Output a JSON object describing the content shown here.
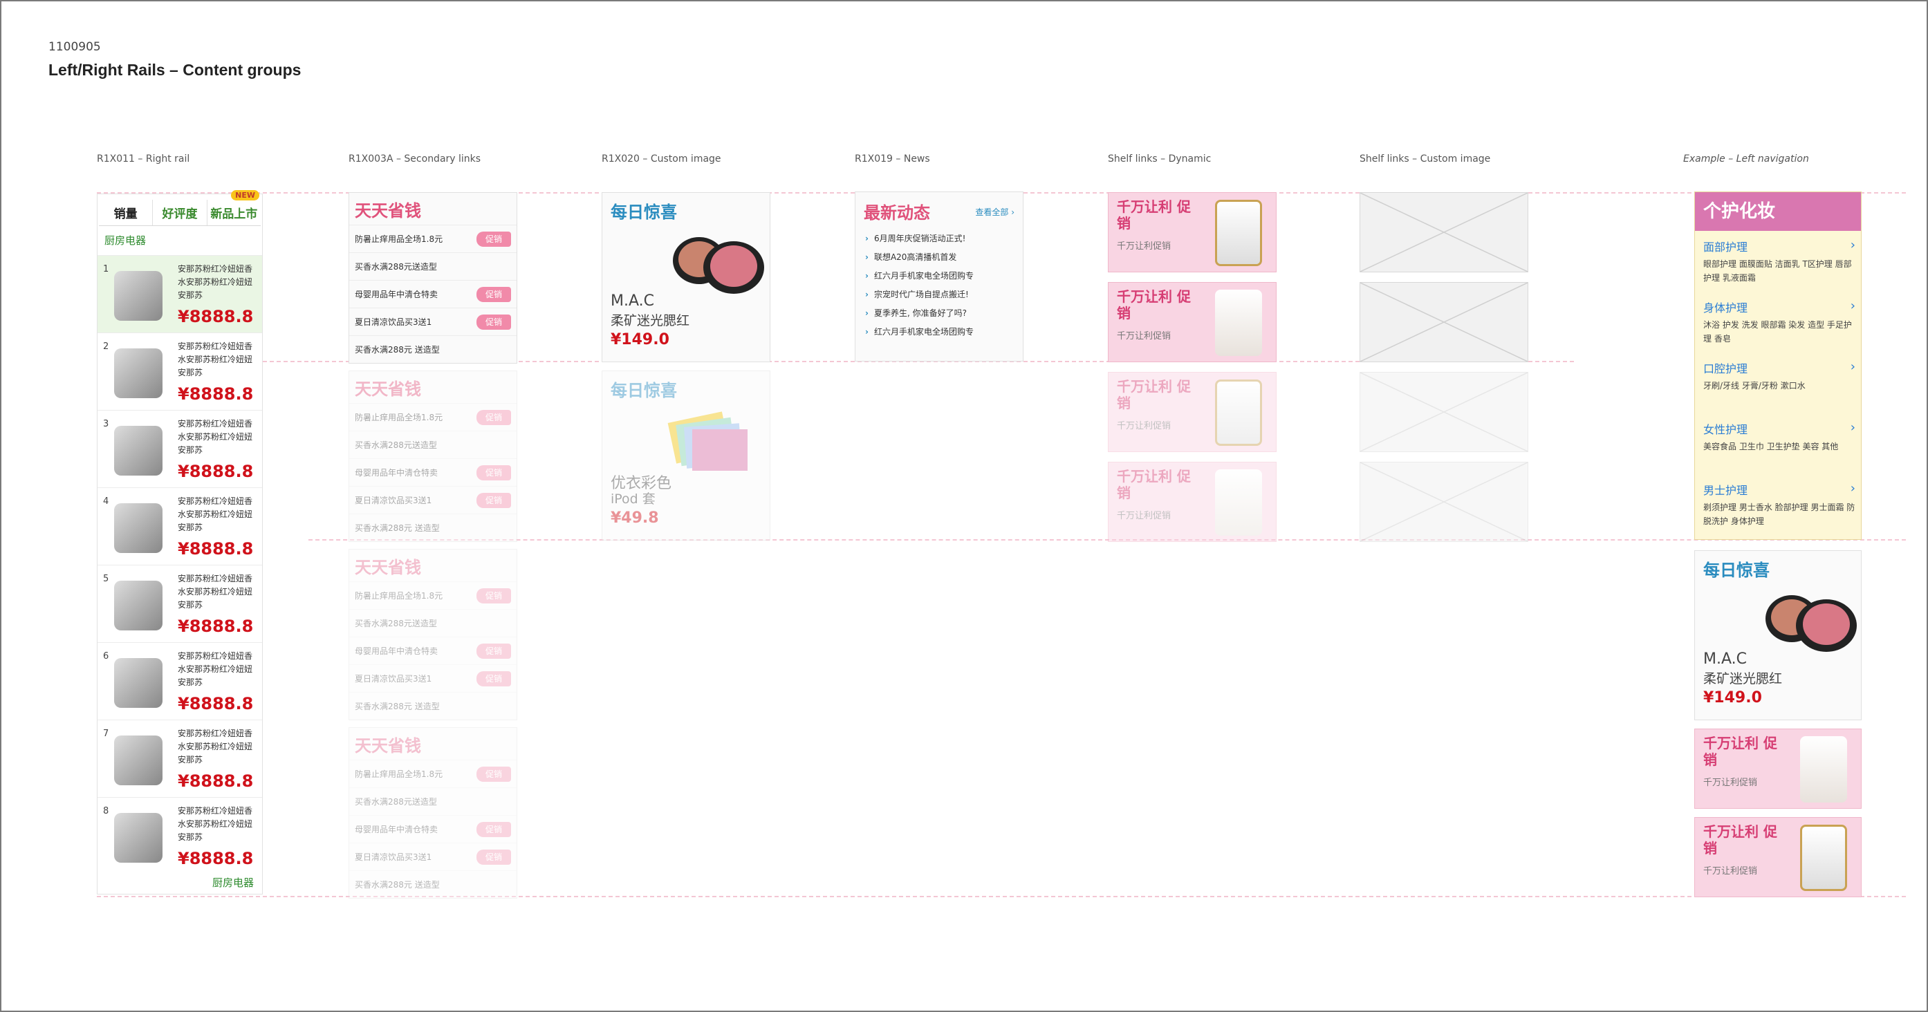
{
  "doc": {
    "id": "1100905",
    "title": "Left/Right Rails – Content groups"
  },
  "labels": {
    "right_rail": "R1X011 – Right rail",
    "secondary_links": "R1X003A – Secondary links",
    "custom_image": "R1X020 – Custom image",
    "news": "R1X019 – News",
    "shelf_dynamic": "Shelf links – Dynamic",
    "shelf_custom": "Shelf links – Custom image",
    "left_nav": "Example – Left navigation"
  },
  "right_rail": {
    "tabs": [
      "销量",
      "好评度",
      "新品上市"
    ],
    "new_badge": "NEW",
    "category": "厨房电器",
    "item_desc": "安那苏粉红冷妞妞香水安那苏粉红冷妞妞安那苏",
    "price": "¥8888.8",
    "ranks": [
      "1",
      "2",
      "3",
      "4",
      "5",
      "6",
      "7",
      "8"
    ],
    "footer_link": "厨房电器"
  },
  "secondary_links": {
    "title": "天天省钱",
    "rows": [
      "防暑止痒用品全场1.8元",
      "买香水满288元送造型",
      "母婴用品年中清仓特卖",
      "夏日清凉饮品买3送1",
      "买香水满288元 送造型"
    ],
    "tag": "促销"
  },
  "custom_image": {
    "title": "每日惊喜",
    "brand": "M.A.C",
    "name": "柔矿迷光腮红",
    "price": "¥149.0",
    "brand2": "优衣彩色",
    "name2": "iPod 套",
    "price2": "¥49.8"
  },
  "news": {
    "title": "最新动态",
    "more": "查看全部 ›",
    "items": [
      "6月周年庆促销活动正式!",
      "联想A20高清播机首发",
      "红六月手机家电全场团购专",
      "宗宠时代广场自提点搬迁!",
      "夏季养生, 你准备好了吗?",
      "红六月手机家电全场团购专"
    ]
  },
  "shelf_dynamic": {
    "title": "千万让利 促销",
    "sub": "千万让利促销"
  },
  "left_nav": {
    "header": "个护化妆",
    "sections": [
      {
        "title": "面部护理",
        "items": "眼部护理 面膜面贴 洁面乳 T区护理 唇部护理 乳液面霜"
      },
      {
        "title": "身体护理",
        "items": "沐浴 护发 洗发 眼部霜 染发 造型 手足护理 香皂"
      },
      {
        "title": "口腔护理",
        "items": "牙刷/牙线 牙膏/牙粉 漱口水"
      },
      {
        "title": "女性护理",
        "items": "美容食品 卫生巾 卫生护垫 美容 其他"
      },
      {
        "title": "男士护理",
        "items": "剃须护理 男士香水 脸部护理 男士面霜 防脱洗护 身体护理"
      }
    ],
    "ci_title": "每日惊喜",
    "ci_brand": "M.A.C",
    "ci_name": "柔矿迷光腮红",
    "ci_price": "¥149.0",
    "sd_title": "千万让利 促销",
    "sd_sub": "千万让利促销"
  },
  "colors": {
    "pink": "#e0527b",
    "blue": "#2a8cbf",
    "price": "#d0121b",
    "green": "#3a8a2e"
  }
}
